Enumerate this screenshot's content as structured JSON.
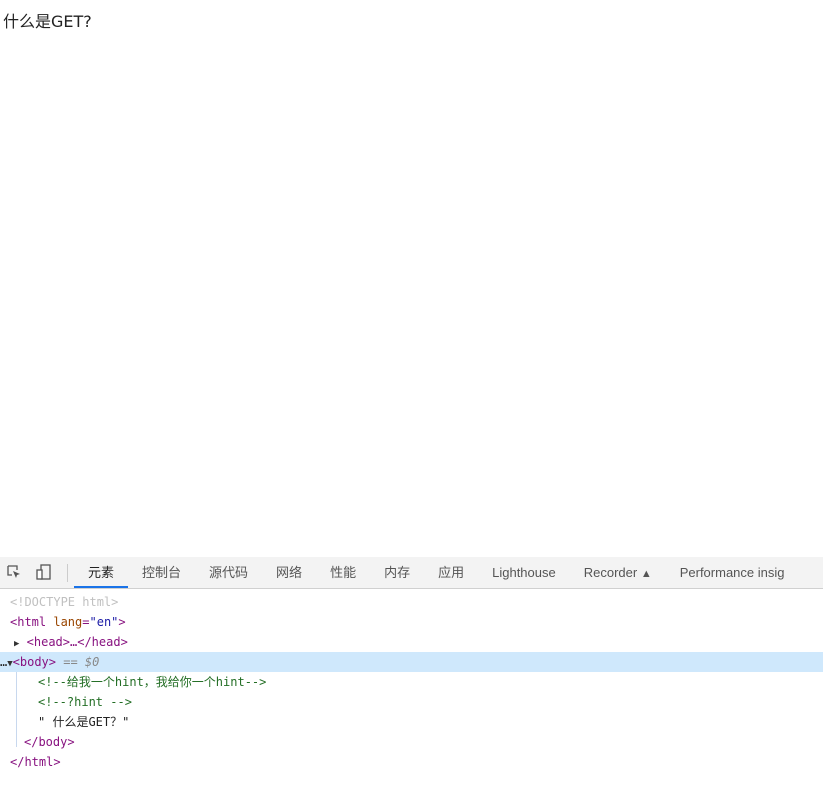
{
  "page": {
    "text": "什么是GET?"
  },
  "devtools": {
    "tabs": [
      {
        "label": "元素",
        "active": true
      },
      {
        "label": "控制台"
      },
      {
        "label": "源代码"
      },
      {
        "label": "网络"
      },
      {
        "label": "性能"
      },
      {
        "label": "内存"
      },
      {
        "label": "应用"
      },
      {
        "label": "Lighthouse"
      },
      {
        "label": "Recorder",
        "icon": "flask-icon"
      },
      {
        "label": "Performance insig"
      }
    ],
    "tree": {
      "doctype": "<!DOCTYPE html>",
      "html_open": "<html",
      "html_attr": "lang",
      "html_attr_val": "\"en\"",
      "head": "<head>…</head>",
      "body_open": "<body>",
      "body_marker": "== $0",
      "dots": "…",
      "comment1": "<!--给我一个hint，我给你一个hint-->",
      "comment2": "<!--?hint -->",
      "text_node": "\" 什么是GET？\"",
      "body_close": "</body>",
      "html_close": "</html>"
    },
    "colors": {
      "selected_row": "#cfe8fc",
      "active_tab": "#1a73e8"
    }
  }
}
